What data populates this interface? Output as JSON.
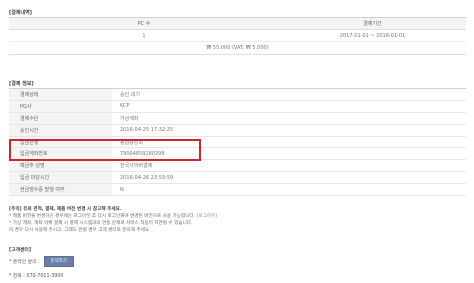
{
  "payment_history": {
    "section_title": "[결제내역]",
    "columns": [
      "PC 수",
      "결제기간"
    ],
    "rows": [
      {
        "pc_count": "1",
        "period": "2017-01-01 ~ 2018-01-01"
      }
    ],
    "total": "₩ 55,000 (VAT: ₩ 5,000)"
  },
  "payment_info": {
    "section_title": "[결제 정보]",
    "rows": [
      {
        "label": "결제상태",
        "value": "승인 대기"
      },
      {
        "label": "PG사",
        "value": "KCP"
      },
      {
        "label": "결제수단",
        "value": "가상계좌"
      },
      {
        "label": "승인시간",
        "value": "2016-04-25 17:32:25"
      },
      {
        "label": "입금은행",
        "value": "농협중앙회"
      },
      {
        "label": "입금계좌번호",
        "value": "79004859180298"
      },
      {
        "label": "예금주 성명",
        "value": "한국사이버결제"
      },
      {
        "label": "입금 마감시간",
        "value": "2016-04-26 23:59:59"
      },
      {
        "label": "현금영수증 발행 여부",
        "value": "N"
      }
    ]
  },
  "notice": {
    "title": "[주의] 유료 견적, 결제, 제품 버전 변경 시 참고해 주세요.",
    "line1": "* 제품 버전을 변경하신 경우에는 로그아웃 후 다시 로그인해야 변경된 버전으로 사용 가능합니다.",
    "line1_link": "[로그아웃]",
    "line2": "* 가상 계좌, 계좌 이체 결제 시 결제 시스템과의 연동 문제로 서비스 적용이 지연될 수 있습니다.",
    "line3": "  이 경우 다시 사용해 주시고, 그래도 안될 경우 고객 센터로 문의해 주세요."
  },
  "contact": {
    "title": "[고객센터]",
    "inquiry_label": "* 온라인 문의 :",
    "inquiry_button": "문의하기",
    "phone": "* 전화 : 070-7011-3900"
  },
  "colors": {
    "highlight_border": "#d2262b",
    "button_bg": "#6a7ea8",
    "header_bg": "#f4f4f4"
  }
}
